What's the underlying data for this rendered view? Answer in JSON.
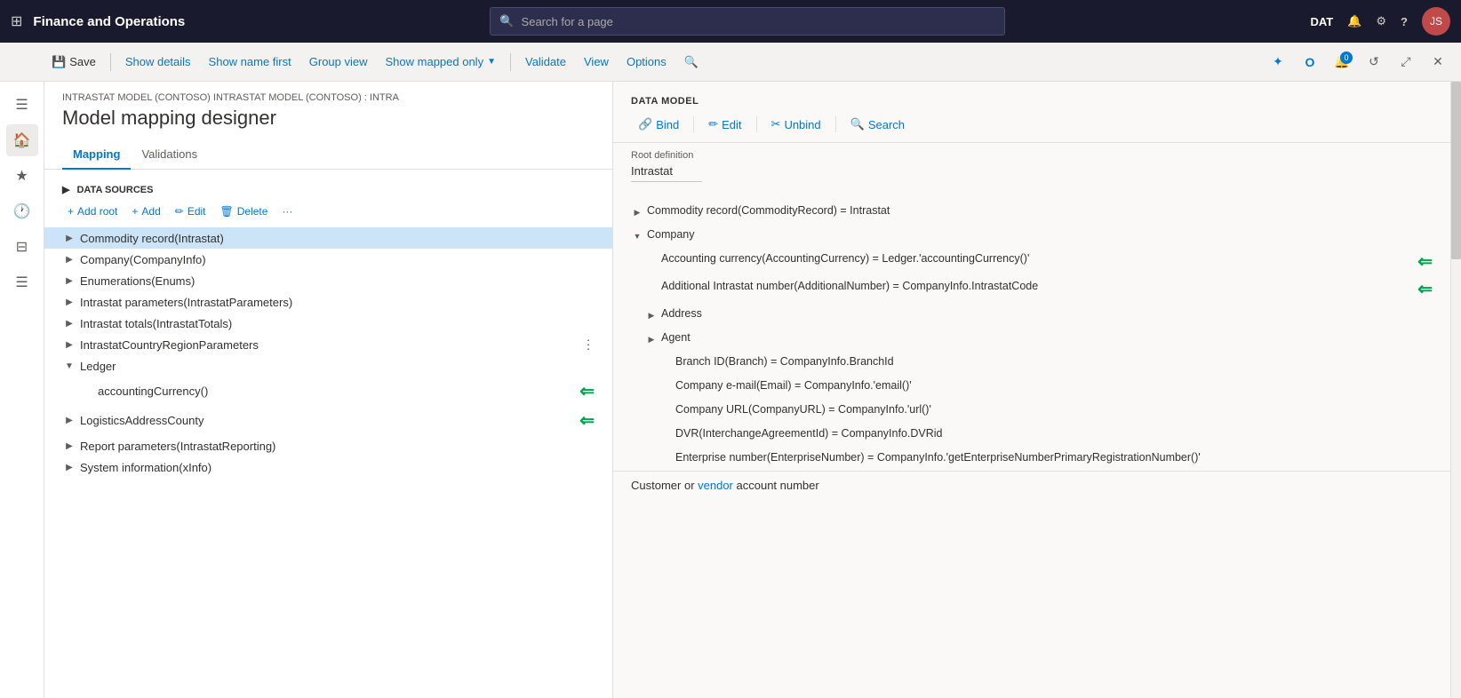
{
  "topnav": {
    "title": "Finance and Operations",
    "search_placeholder": "Search for a page",
    "env": "DAT"
  },
  "toolbar": {
    "save": "Save",
    "show_details": "Show details",
    "show_name_first": "Show name first",
    "group_view": "Group view",
    "show_mapped_only": "Show mapped only",
    "validate": "Validate",
    "view": "View",
    "options": "Options"
  },
  "page": {
    "breadcrumb": "INTRASTAT MODEL (CONTOSO) INTRASTAT MODEL (CONTOSO) : INTRA",
    "title": "Model mapping designer",
    "tab_mapping": "Mapping",
    "tab_validations": "Validations"
  },
  "datasources": {
    "section_label": "DATA SOURCES",
    "add_root": "+ Add root",
    "add": "+ Add",
    "edit": "Edit",
    "delete": "Delete",
    "items": [
      {
        "id": "commodity",
        "label": "Commodity record(Intrastat)",
        "level": 1,
        "expanded": false,
        "selected": true
      },
      {
        "id": "company",
        "label": "Company(CompanyInfo)",
        "level": 1,
        "expanded": false,
        "selected": false
      },
      {
        "id": "enumerations",
        "label": "Enumerations(Enums)",
        "level": 1,
        "expanded": false,
        "selected": false
      },
      {
        "id": "intrastat_params",
        "label": "Intrastat parameters(IntrastatParameters)",
        "level": 1,
        "expanded": false,
        "selected": false
      },
      {
        "id": "intrastat_totals",
        "label": "Intrastat totals(IntrastatTotals)",
        "level": 1,
        "expanded": false,
        "selected": false
      },
      {
        "id": "intrastat_country",
        "label": "IntrastatCountryRegionParameters",
        "level": 1,
        "expanded": false,
        "selected": false
      },
      {
        "id": "ledger",
        "label": "Ledger",
        "level": 1,
        "expanded": true,
        "selected": false
      },
      {
        "id": "accounting_currency",
        "label": "accountingCurrency()",
        "level": 2,
        "expanded": false,
        "selected": false
      },
      {
        "id": "logistics_address",
        "label": "LogisticsAddressCounty",
        "level": 1,
        "expanded": false,
        "selected": false
      },
      {
        "id": "report_params",
        "label": "Report parameters(IntrastatReporting)",
        "level": 1,
        "expanded": false,
        "selected": false
      },
      {
        "id": "system_info",
        "label": "System information(xInfo)",
        "level": 1,
        "expanded": false,
        "selected": false
      }
    ]
  },
  "data_model": {
    "section_label": "DATA MODEL",
    "bind": "Bind",
    "edit": "Edit",
    "unbind": "Unbind",
    "search": "Search",
    "root_definition_label": "Root definition",
    "root_definition_value": "Intrastat",
    "items": [
      {
        "id": "commodity_record",
        "label": "Commodity record(CommodityRecord) = Intrastat",
        "level": 0,
        "expanded": false
      },
      {
        "id": "company_node",
        "label": "Company",
        "level": 0,
        "expanded": true
      },
      {
        "id": "accounting_currency",
        "label": "Accounting currency(AccountingCurrency) = Ledger.'accountingCurrency()'",
        "level": 1,
        "has_arrow": true
      },
      {
        "id": "additional_intrastat",
        "label": "Additional Intrastat number(AdditionalNumber) = CompanyInfo.IntrastatCode",
        "level": 1,
        "has_arrow": true
      },
      {
        "id": "address",
        "label": "Address",
        "level": 1,
        "expanded": false
      },
      {
        "id": "agent",
        "label": "Agent",
        "level": 1,
        "expanded": false
      },
      {
        "id": "branch_id",
        "label": "Branch ID(Branch) = CompanyInfo.BranchId",
        "level": 2
      },
      {
        "id": "company_email",
        "label": "Company e-mail(Email) = CompanyInfo.'email()'",
        "level": 2
      },
      {
        "id": "company_url",
        "label": "Company URL(CompanyURL) = CompanyInfo.'url()'",
        "level": 2
      },
      {
        "id": "dvr",
        "label": "DVR(InterchangeAgreementId) = CompanyInfo.DVRid",
        "level": 2
      },
      {
        "id": "enterprise_number",
        "label": "Enterprise number(EnterpriseNumber) = CompanyInfo.'getEnterpriseNumberPrimaryRegistrationNumber()'",
        "level": 2
      }
    ],
    "bottom_text_pre": "Customer or ",
    "bottom_link": "vendor",
    "bottom_text_post": " account number"
  },
  "icons": {
    "grid": "⊞",
    "search": "🔍",
    "home": "🏠",
    "star": "★",
    "clock": "🕐",
    "table": "⊟",
    "list": "☰",
    "filter": "▽",
    "bell": "🔔",
    "gear": "⚙",
    "question": "?",
    "save": "💾",
    "add": "+",
    "edit": "✏",
    "delete": "🗑",
    "bind": "🔗",
    "unbind": "✂",
    "link_icon": "🔗",
    "expand_right": "▶",
    "expand_down": "▼",
    "collapse": "◀",
    "close": "✕",
    "refresh": "↺",
    "maximize": "⤢"
  }
}
